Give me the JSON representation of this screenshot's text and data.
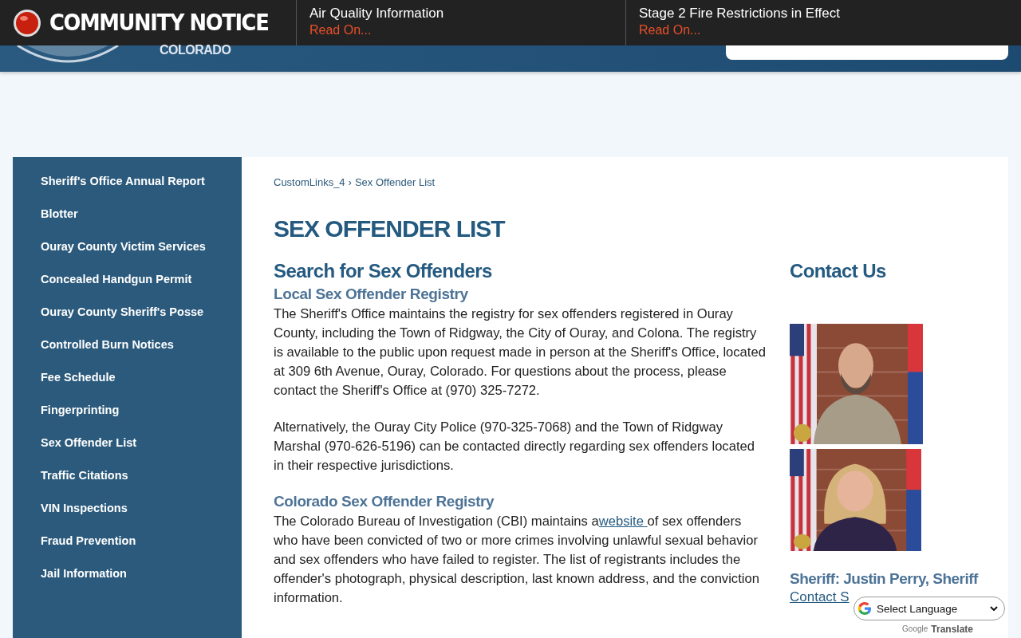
{
  "notice": {
    "title": "COMMUNITY NOTICE",
    "items": [
      {
        "title": "Air Quality Information",
        "link": "Read On..."
      },
      {
        "title": "Stage 2 Fire Restrictions in Effect",
        "link": "Read On..."
      }
    ]
  },
  "header": {
    "state_name": "COLORADO"
  },
  "sidebar": {
    "items": [
      {
        "label": "Sheriff's Office Annual Report",
        "selected": false
      },
      {
        "label": "Blotter",
        "selected": false
      },
      {
        "label": "Ouray County Victim Services",
        "selected": false
      },
      {
        "label": "Concealed Handgun Permit",
        "selected": false
      },
      {
        "label": "Ouray County Sheriff's Posse",
        "selected": false
      },
      {
        "label": "Controlled Burn Notices",
        "selected": false
      },
      {
        "label": "Fee Schedule",
        "selected": false
      },
      {
        "label": "Fingerprinting",
        "selected": false
      },
      {
        "label": "Sex Offender List",
        "selected": false
      },
      {
        "label": "Traffic Citations",
        "selected": false
      },
      {
        "label": "VIN Inspections",
        "selected": false
      },
      {
        "label": "Fraud Prevention",
        "selected": false
      },
      {
        "label": "Jail Information",
        "selected": false
      }
    ]
  },
  "breadcrumb": {
    "separator": "›",
    "items": [
      "CustomLinks_4",
      "Sex Offender List"
    ]
  },
  "page_title": "SEX OFFENDER LIST",
  "main": {
    "heading": "Search for Sex Offenders",
    "sections": [
      {
        "subheading": "Local Sex Offender Registry",
        "paragraphs": [
          {
            "before": "The Sheriff's Office maintains the registry for sex offenders registered in Ouray County, including the Town of Ridgway, the City of Ouray, and Colona. The registry is available to the public upon request made in person at the Sheriff's Office, located at 309 6th Avenue, Ouray, Colorado. For questions about the process, please contact the Sheriff's Office at (970) 325-7272."
          },
          {
            "before": "Alternatively, the Ouray City Police (970-325-7068) and the Town of Ridgway Marshal (970-626-5196) can be contacted directly regarding sex offenders located in their respective jurisdictions."
          }
        ]
      },
      {
        "subheading": "Colorado Sex Offender Registry",
        "paragraphs": [
          {
            "before": "The Colorado Bureau of Investigation (CBI) maintains a",
            "link": "website ",
            "after": "of sex offenders who have been convicted of two or more crimes involving unlawful sexual behavior and sex offenders who have failed to register. The list of registrants includes the offender's photograph, physical description, last known address, and the conviction information."
          }
        ]
      }
    ]
  },
  "contact": {
    "heading": "Contact Us",
    "name": "Sheriff: Justin Perry, Sheriff",
    "link": "Contact S"
  },
  "translate": {
    "select": "Select Language",
    "brand": "Google",
    "label": "Translate"
  }
}
